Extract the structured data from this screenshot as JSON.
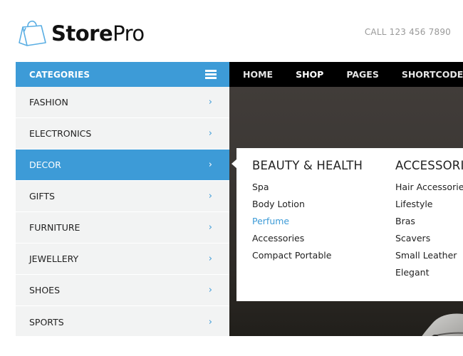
{
  "brand": {
    "name_bold": "Store",
    "name_light": "Pro",
    "logo_icon": "shopping-bag-icon",
    "accent_color": "#3d9bd7"
  },
  "header": {
    "phone": "CALL 123 456 7890"
  },
  "sidebar": {
    "title": "CATEGORIES",
    "menu_icon": "hamburger-icon",
    "items": [
      {
        "label": "FASHION",
        "active": false
      },
      {
        "label": "ELECTRONICS",
        "active": false
      },
      {
        "label": "DECOR",
        "active": true
      },
      {
        "label": "GIFTS",
        "active": false
      },
      {
        "label": "FURNITURE",
        "active": false
      },
      {
        "label": "JEWELLERY",
        "active": false
      },
      {
        "label": "SHOES",
        "active": false
      },
      {
        "label": "SPORTS",
        "active": false
      }
    ],
    "chevron": "›"
  },
  "nav": {
    "items": [
      "HOME",
      "SHOP",
      "PAGES",
      "SHORTCODES"
    ]
  },
  "mega_menu": {
    "columns": [
      {
        "heading": "BEAUTY & HEALTH",
        "links": [
          "Spa",
          "Body Lotion",
          "Perfume",
          "Accessories",
          "Compact Portable"
        ],
        "highlighted": "Perfume"
      },
      {
        "heading": "ACCESSORIES",
        "links": [
          "Hair Accessories",
          "Lifestyle",
          "Bras",
          "Scavers",
          "Small Leather",
          "Elegant"
        ]
      }
    ]
  }
}
